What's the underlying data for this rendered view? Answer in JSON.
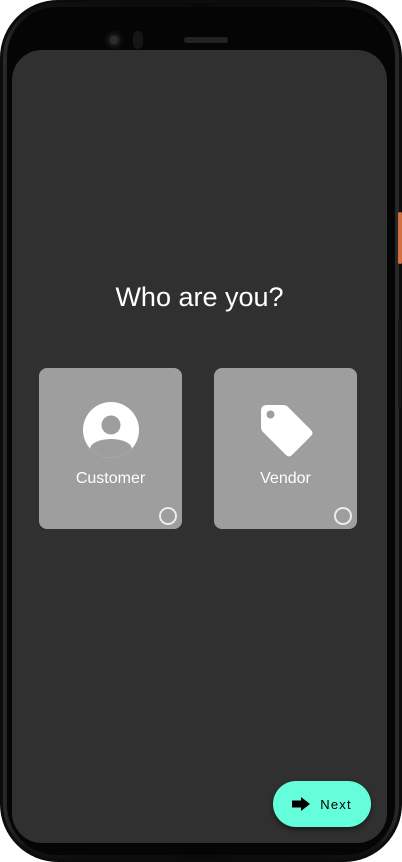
{
  "screen": {
    "heading": "Who are you?",
    "options": [
      {
        "label": "Customer",
        "icon": "account-circle-icon",
        "selected": false
      },
      {
        "label": "Vendor",
        "icon": "tag-icon",
        "selected": false
      }
    ],
    "next_button": {
      "label": "Next",
      "icon": "arrow-right-icon"
    }
  },
  "colors": {
    "screen_background": "#303030",
    "card_background": "#9e9e9e",
    "accent": "#64ffda",
    "text": "#ffffff"
  }
}
